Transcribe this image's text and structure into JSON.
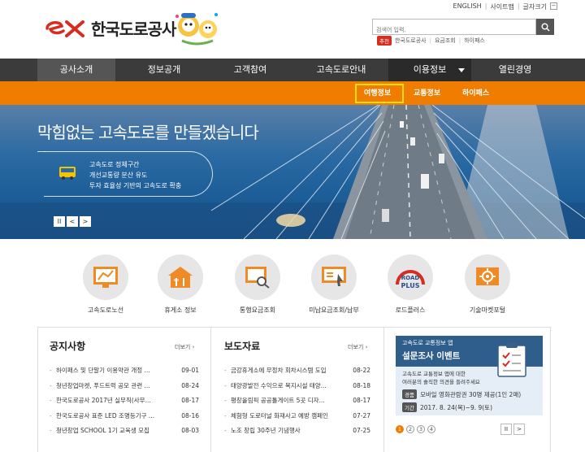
{
  "header": {
    "logo_text": "한국도로공사",
    "util_links": [
      "ENGLISH",
      "사이트맵",
      "글자크기"
    ],
    "search_placeholder": "검색어 입력.",
    "quick_badge": "추천",
    "quick_links": [
      "한국도로공사",
      "요금조회",
      "하이패스"
    ]
  },
  "gnb": {
    "items": [
      "공사소개",
      "정보공개",
      "고객참여",
      "고속도로안내",
      "이용정보",
      "열린경영"
    ]
  },
  "submenu": {
    "items": [
      "여행정보",
      "교통정보",
      "하이패스"
    ]
  },
  "hero": {
    "title": "막힘없는 고속도로를 만들겠습니다",
    "lines": [
      "고속도로 정체구간",
      "개선교통량 분산 유도",
      "투자 효율성 기반의 고속도로 확충"
    ],
    "controls": [
      "II",
      "<",
      ">"
    ]
  },
  "quick_menu": [
    {
      "label": "고속도로노선",
      "icon": "route-map-icon"
    },
    {
      "label": "휴게소 정보",
      "icon": "rest-area-icon"
    },
    {
      "label": "통행요금조회",
      "icon": "toll-search-icon"
    },
    {
      "label": "미납요금조회/납부",
      "icon": "unpaid-toll-icon"
    },
    {
      "label": "로드플러스",
      "icon": "road-plus-icon"
    },
    {
      "label": "기술마켓포털",
      "icon": "tech-market-icon"
    }
  ],
  "notice": {
    "title": "공지사항",
    "more": "더보기",
    "items": [
      {
        "text": "하이패스 및 단말기 이용약관 개정 ...",
        "date": "09-01"
      },
      {
        "text": "청년창업마켓, 푸드트럭 공모 관련 ...",
        "date": "08-24"
      },
      {
        "text": "한국도로공사 2017년 실무직(사무...",
        "date": "08-17"
      },
      {
        "text": "한국도로공사 표준 LED 조명등기구 ...",
        "date": "08-16"
      },
      {
        "text": "청년창업 SCHOOL 1기 교육생 모집",
        "date": "08-03"
      }
    ]
  },
  "press": {
    "title": "보도자료",
    "more": "더보기",
    "items": [
      {
        "text": "금강휴게소에 무정차 회차시스템 도입",
        "date": "08-22"
      },
      {
        "text": "태양광발전 수익으로 복지시설 태양...",
        "date": "08-18"
      },
      {
        "text": "평창올림픽 공공톨게이트 5곳 디자...",
        "date": "08-17"
      },
      {
        "text": "체험형 도로터널 화재사고 예방 캠페인",
        "date": "07-27"
      },
      {
        "text": "노조 창립 30주년 기념행사",
        "date": "07-25"
      }
    ]
  },
  "event": {
    "subtitle": "고속도로 교통정보 앱",
    "title": "설문조사 이벤트",
    "desc": [
      "고속도로 교통정보 앱에 대한",
      "여러분의 솔직한 의견을 들려주세요"
    ],
    "prize_tag": "경품",
    "prize": "모바일 영화관람권 30명 제공(1인 2매)",
    "period_tag": "기간",
    "period": "2017. 8. 24(목)~9. 9(토)",
    "pages": [
      "1",
      "2",
      "3",
      "4"
    ],
    "controls": [
      "II",
      ">"
    ]
  },
  "colors": {
    "brand_orange": "#f07c00",
    "gnb_dark": "#3b3b3b",
    "brand_red": "#d62d20",
    "hero_blue": "#1c5d97"
  }
}
